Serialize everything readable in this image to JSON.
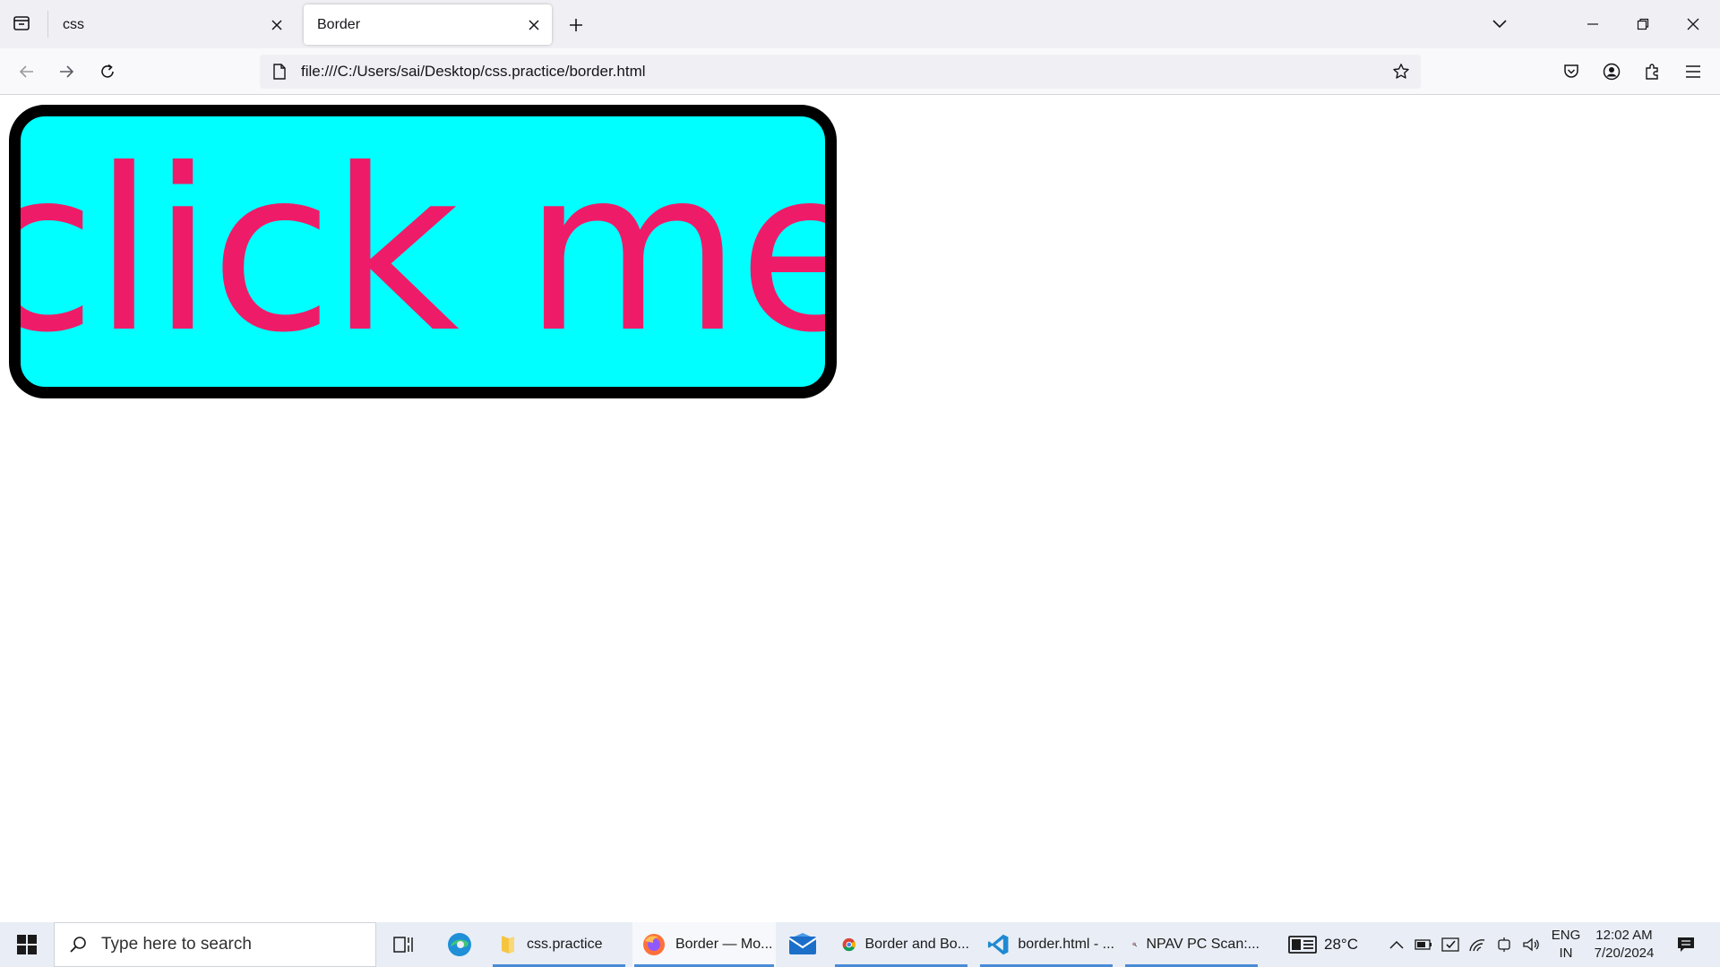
{
  "browser": {
    "tabs": [
      {
        "title": "css",
        "active": false
      },
      {
        "title": "Border",
        "active": true
      }
    ],
    "url": "file:///C:/Users/sai/Desktop/css.practice/border.html"
  },
  "page": {
    "button_label": "click me",
    "colors": {
      "button_bg": "#00ffff",
      "button_text": "#ee1c68",
      "button_border": "#000000"
    }
  },
  "taskbar": {
    "search_placeholder": "Type here to search",
    "apps": [
      {
        "label": "css.practice",
        "icon": "folder-icon"
      },
      {
        "label": "Border — Mo...",
        "icon": "firefox-icon"
      },
      {
        "label": "Border and Bo...",
        "icon": "chrome-icon"
      },
      {
        "label": "border.html - ...",
        "icon": "vscode-icon"
      },
      {
        "label": "NPAV PC Scan:...",
        "icon": "npav-icon"
      }
    ],
    "weather": "28°C",
    "lang_line1": "ENG",
    "lang_line2": "IN",
    "time": "12:02 AM",
    "date": "7/20/2024"
  }
}
